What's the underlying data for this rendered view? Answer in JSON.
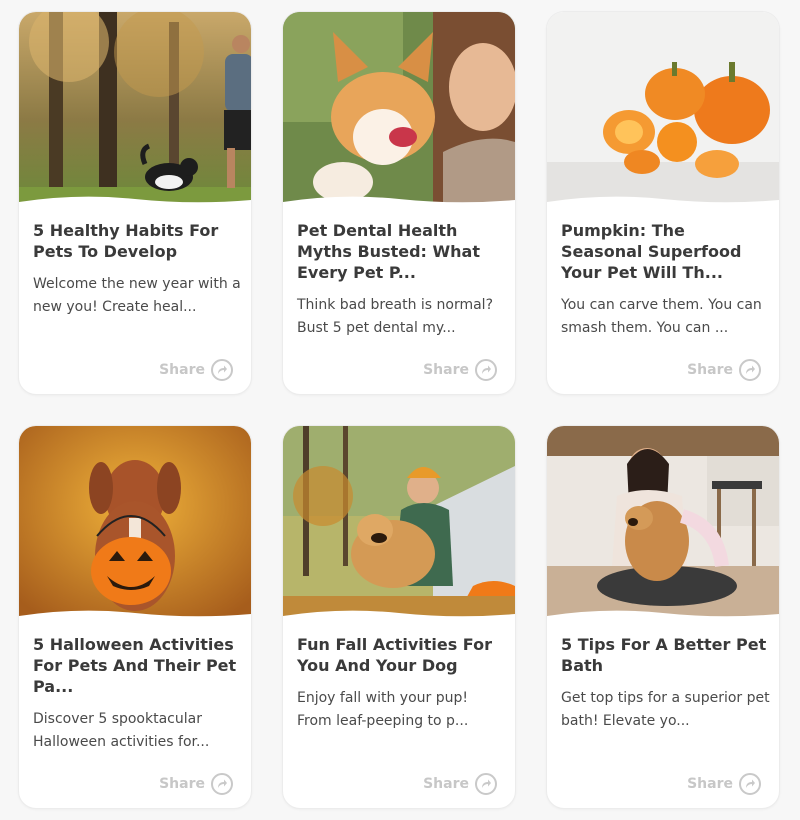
{
  "cards": [
    {
      "title": "5 Healthy Habits For Pets To Develop",
      "description": "Welcome the new year with a new you! Create heal...",
      "share_label": "Share",
      "image": "man-jogging-with-border-collie"
    },
    {
      "title": "Pet Dental Health Myths Busted: What Every Pet P...",
      "description": "Think bad breath is normal? Bust 5 pet dental my...",
      "share_label": "Share",
      "image": "woman-hugging-corgi"
    },
    {
      "title": "Pumpkin: The Seasonal Superfood Your Pet Will Th...",
      "description": "You can carve them. You can smash them. You can ...",
      "share_label": "Share",
      "image": "orange-pumpkins"
    },
    {
      "title": "5 Halloween Activities For Pets And Their Pet Pa...",
      "description": "Discover 5 spooktacular Halloween activities for...",
      "share_label": "Share",
      "image": "dog-with-jack-o-lantern"
    },
    {
      "title": "Fun Fall Activities For You And Your Dog",
      "description": "Enjoy fall with your pup! From leaf-peeping to p...",
      "share_label": "Share",
      "image": "woman-camping-with-golden-retriever"
    },
    {
      "title": "5 Tips For A Better Pet Bath",
      "description": "Get top tips for a superior pet bath! Elevate yo...",
      "share_label": "Share",
      "image": "woman-toweling-cocker-spaniel"
    }
  ]
}
